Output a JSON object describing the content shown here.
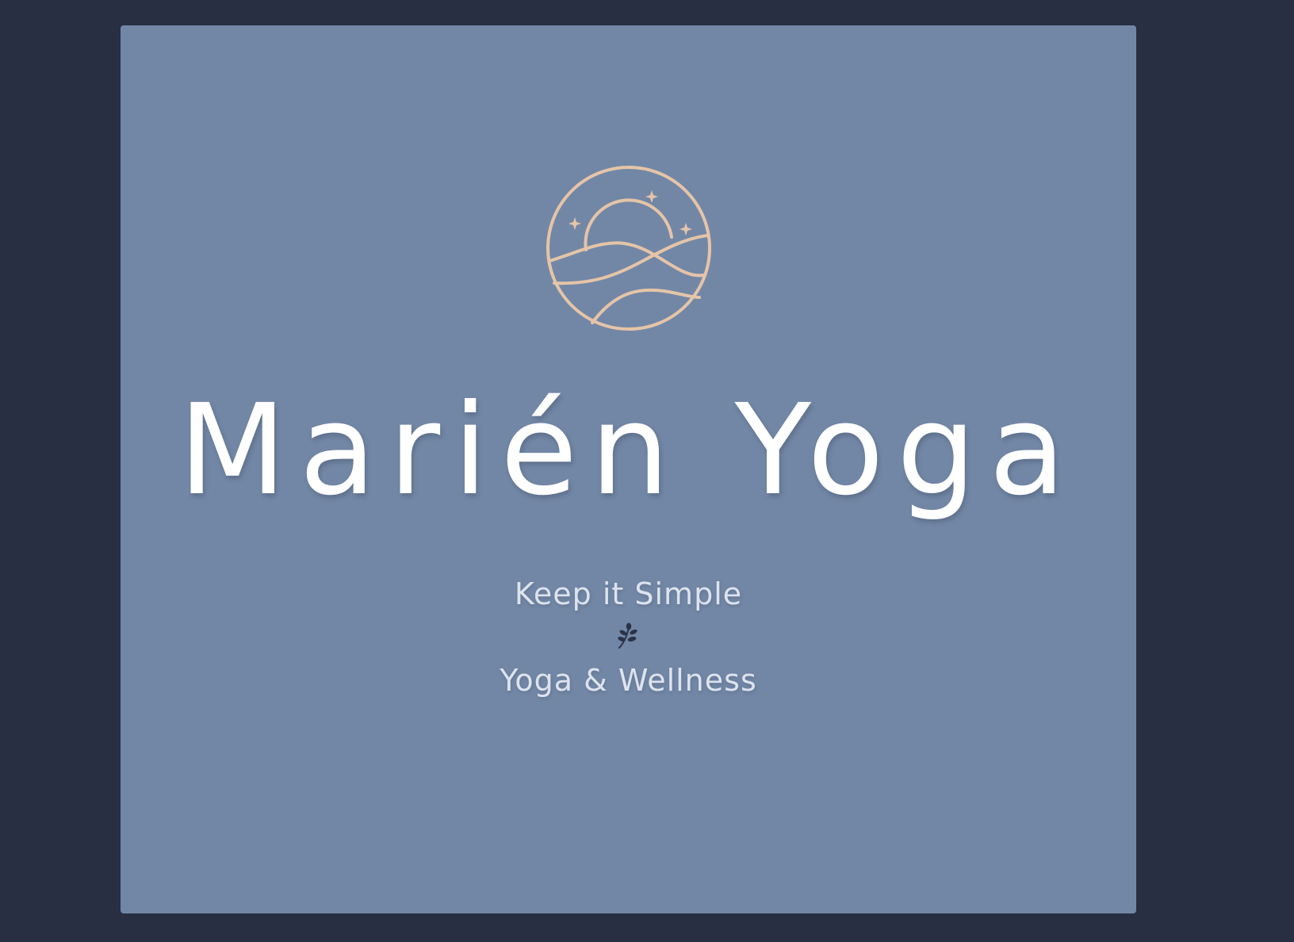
{
  "hero": {
    "title": "Marién Yoga",
    "tagline_top": "Keep it Simple",
    "tagline_bottom": "Yoga & Wellness"
  },
  "icons": {
    "logo": "sun-over-hills-circle-logo",
    "divider": "leaf-sprig-icon"
  },
  "colors": {
    "page_background": "#282f43",
    "card_background": "#7287a6",
    "logo_stroke": "#e5c4a8",
    "title_text": "#ffffff",
    "tagline_text": "#dde3ee",
    "leaf": "#2a3247"
  }
}
